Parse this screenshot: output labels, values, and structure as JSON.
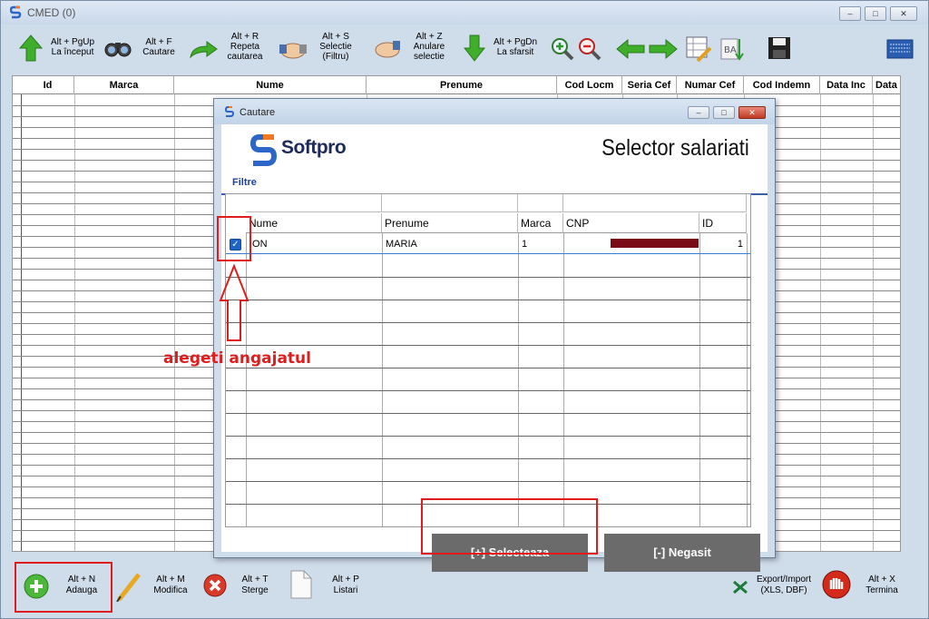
{
  "window": {
    "title": "CMED  (0)",
    "controls": [
      "–",
      "□",
      "✕"
    ]
  },
  "toolbar": [
    {
      "key": "Alt + PgUp",
      "label": "La început",
      "icon": "up-arrow-icon"
    },
    {
      "key": "Alt + F",
      "label": "Cautare",
      "icon": "binoculars-icon"
    },
    {
      "key": "Alt + R",
      "label": "Repeta",
      "label2": "cautarea",
      "icon": "repeat-arrow-icon"
    },
    {
      "key": "Alt + S",
      "label": "Selectie",
      "label2": "(Filtru)",
      "icon": "handshake-icon"
    },
    {
      "key": "Alt + Z",
      "label": "Anulare",
      "label2": "selectie",
      "icon": "hand-cancel-icon"
    },
    {
      "key": "Alt + PgDn",
      "label": "La sfarsit",
      "icon": "down-arrow-icon"
    }
  ],
  "grid": {
    "headers": [
      "Id",
      "Marca",
      "Nume",
      "Prenume",
      "Cod Locm",
      "Seria Cef",
      "Numar Cef",
      "Cod Indemn",
      "Data Inc",
      "Data S"
    ]
  },
  "bottombar": {
    "add": {
      "key": "Alt + N",
      "label": "Adauga"
    },
    "modify": {
      "key": "Alt + M",
      "label": "Modifica"
    },
    "delete": {
      "key": "Alt + T",
      "label": "Sterge"
    },
    "lists": {
      "key": "Alt + P",
      "label": "Listari"
    },
    "export": {
      "key": "Export/Import",
      "label": "(XLS, DBF)"
    },
    "exit": {
      "key": "Alt + X",
      "label": "Termina"
    }
  },
  "dialog": {
    "title": "Cautare",
    "brand": "Softpro",
    "heading": "Selector salariati",
    "filters_label": "Filtre",
    "columns": [
      "Nume",
      "Prenume",
      "Marca",
      "CNP",
      "ID"
    ],
    "rows": [
      {
        "checked": true,
        "nume": "ION",
        "prenume": "MARIA",
        "marca": "1",
        "cnp": "",
        "id": "1"
      }
    ],
    "select_button": "[+]  Selecteaza",
    "notfound_button": "[-]  Negasit"
  },
  "annotation": "alegeti angajatul",
  "colors": {
    "accent_red": "#e01c1c",
    "button_gray": "#6b6b6b",
    "checkbox_blue": "#1e63c8",
    "cnp_mask": "#7a0a16"
  }
}
